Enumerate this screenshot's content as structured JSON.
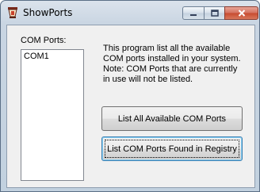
{
  "window": {
    "title": "ShowPorts",
    "icon": "app-icon"
  },
  "caption_buttons": {
    "minimize_icon": "minimize-icon",
    "maximize_icon": "maximize-icon",
    "close_icon": "close-icon"
  },
  "ports": {
    "label": "COM Ports:",
    "items": [
      "COM1"
    ]
  },
  "info_text": "This program list all the available COM ports installed in your system. Note: COM Ports that are currently in use will not be listed.",
  "buttons": {
    "list_all_label": "List All Available COM Ports",
    "list_registry_label": "List COM Ports Found in Registry"
  },
  "colors": {
    "titlebar": "#c9d5e2",
    "close_button": "#c74a2f",
    "client_background": "#f0f0f0",
    "focused_button_border": "#3c7fb1"
  }
}
